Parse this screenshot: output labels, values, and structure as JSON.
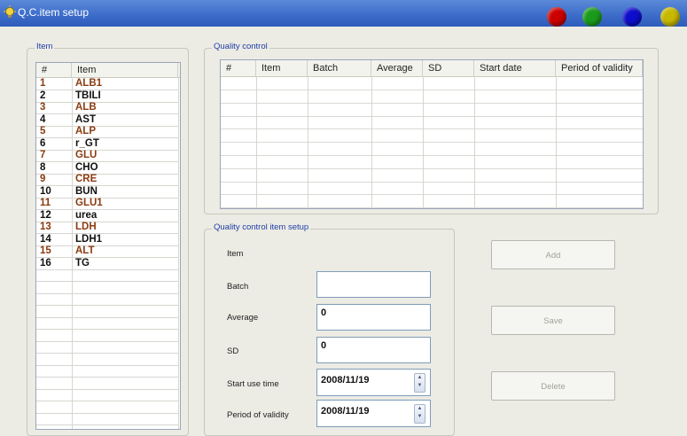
{
  "window": {
    "title": "Q.C.item setup",
    "status_dots": [
      "#cc0000",
      "#1b9b1b",
      "#0d0dcc",
      "#c8b800"
    ]
  },
  "item_panel": {
    "legend": "Item",
    "columns": [
      "#",
      "Item"
    ],
    "rows": [
      {
        "num": "1",
        "name": "ALB1",
        "color": "#8b3b10"
      },
      {
        "num": "2",
        "name": "TBILI",
        "color": "#111111"
      },
      {
        "num": "3",
        "name": "ALB",
        "color": "#8b3b10"
      },
      {
        "num": "4",
        "name": "AST",
        "color": "#111111"
      },
      {
        "num": "5",
        "name": "ALP",
        "color": "#8b3b10"
      },
      {
        "num": "6",
        "name": "r_GT",
        "color": "#111111"
      },
      {
        "num": "7",
        "name": "GLU",
        "color": "#8b3b10"
      },
      {
        "num": "8",
        "name": "CHO",
        "color": "#111111"
      },
      {
        "num": "9",
        "name": "CRE",
        "color": "#8b3b10"
      },
      {
        "num": "10",
        "name": "BUN",
        "color": "#111111"
      },
      {
        "num": "11",
        "name": "GLU1",
        "color": "#8b3b10"
      },
      {
        "num": "12",
        "name": "urea",
        "color": "#111111"
      },
      {
        "num": "13",
        "name": "LDH",
        "color": "#8b3b10"
      },
      {
        "num": "14",
        "name": "LDH1",
        "color": "#111111"
      },
      {
        "num": "15",
        "name": "ALT",
        "color": "#8b3b10"
      },
      {
        "num": "16",
        "name": "TG",
        "color": "#111111"
      }
    ]
  },
  "qc_panel": {
    "legend": "Quality control",
    "columns": [
      "#",
      "Item",
      "Batch",
      "Average",
      "SD",
      "Start date",
      "Period of validity"
    ]
  },
  "setup_panel": {
    "legend": "Quality control item setup",
    "labels": {
      "item": "Item",
      "batch": "Batch",
      "average": "Average",
      "sd": "SD",
      "start": "Start use time",
      "validity": "Period of validity"
    },
    "values": {
      "batch": "",
      "average": "0",
      "sd": "0",
      "start": "2008/11/19",
      "validity": "2008/11/19"
    }
  },
  "buttons": {
    "add": "Add",
    "save": "Save",
    "delete": "Delete"
  }
}
